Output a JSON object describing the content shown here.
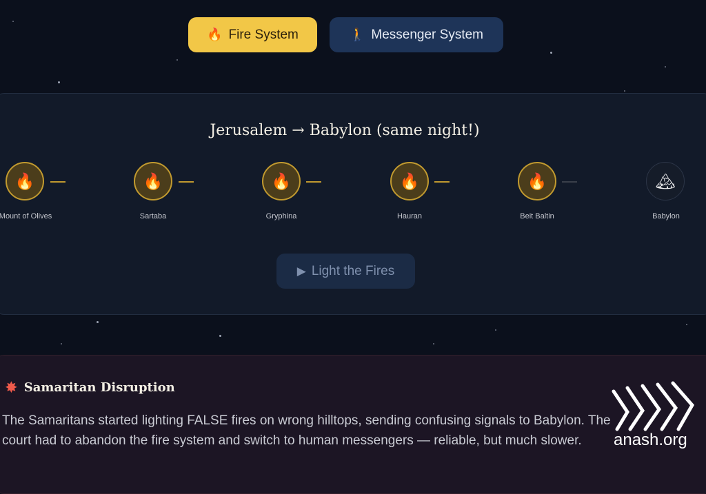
{
  "toggle": {
    "fire": {
      "icon": "fire-icon",
      "glyph": "🔥",
      "label": "Fire System"
    },
    "messenger": {
      "icon": "walking-person-icon",
      "glyph": "🚶",
      "label": "Messenger System"
    }
  },
  "route": {
    "title": "Jerusalem → Babylon (same night!)",
    "stations": [
      {
        "glyph": "🔥",
        "label": "Mount of Olives",
        "lit": true
      },
      {
        "glyph": "🔥",
        "label": "Sartaba",
        "lit": true
      },
      {
        "glyph": "🔥",
        "label": "Gryphina",
        "lit": true
      },
      {
        "glyph": "🔥",
        "label": "Hauran",
        "lit": true
      },
      {
        "glyph": "🔥",
        "label": "Beit Baltin",
        "lit": true
      },
      {
        "glyph": "🏔",
        "label": "Babylon",
        "lit": false
      }
    ]
  },
  "action": {
    "play_glyph": "▶",
    "label": "Light the Fires"
  },
  "alert": {
    "icon": "burst-icon",
    "glyph": "✸",
    "title": "Samaritan Disruption",
    "line1": "The Samaritans started lighting FALSE fires on wrong hilltops, sending confusing signals to Babylon. The",
    "line2": "court had to abandon the fire system and switch to human messengers — reliable, but much slower."
  },
  "watermark": {
    "text": "anash.org"
  },
  "colors": {
    "accent_gold": "#f2c747",
    "panel": "#121a29",
    "messenger_blue": "#1e3458",
    "alert_red": "#ef5a4b"
  }
}
